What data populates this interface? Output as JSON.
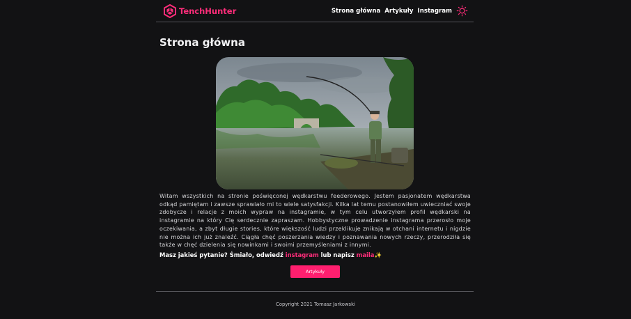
{
  "header": {
    "logo_text": "TenchHunter",
    "nav": [
      "Strona główna",
      "Artykuły",
      "Instagram"
    ],
    "theme_toggle_icon": "sun-icon"
  },
  "main": {
    "title": "Strona główna",
    "paragraph": "Witam wszystkich na stronie poświęconej wędkarstwu feederowego. Jestem pasjonatem wędkarstwa odkąd pamiętam i zawsze sprawiało mi to wiele satysfakcji. Kilka lat temu postanowiłem uwieczniać swoje zdobycze i relacje z moich wypraw na instagramie, w tym celu utworzyłem profil wędkarski na instagramie na który Cię serdecznie zapraszam. Hobbystyczne prowadzenie instagrama przerosło moje oczekiwania, a zbyt długie stories, które większość ludzi przeklikuje znikają w otchani internetu i nigdzie nie można ich już znaleźć. Ciągła chęć poszerzania wiedzy i poznawania nowych rzeczy, przerodziła się także w chęć dzielenia się nowinkami i swoimi przemyśleniami z innymi.",
    "ask_prefix": "Masz jakieś pytanie? Śmiało, odwiedź ",
    "ask_link1": "instagram",
    "ask_middle": " lub napisz ",
    "ask_link2": "maila",
    "ask_suffix": "✨",
    "button_label": "Artykuły"
  },
  "footer": {
    "copyright": "Copyright 2021 Tomasz Jarkowski"
  },
  "colors": {
    "accent": "#ff1f6f",
    "background": "#121214"
  }
}
